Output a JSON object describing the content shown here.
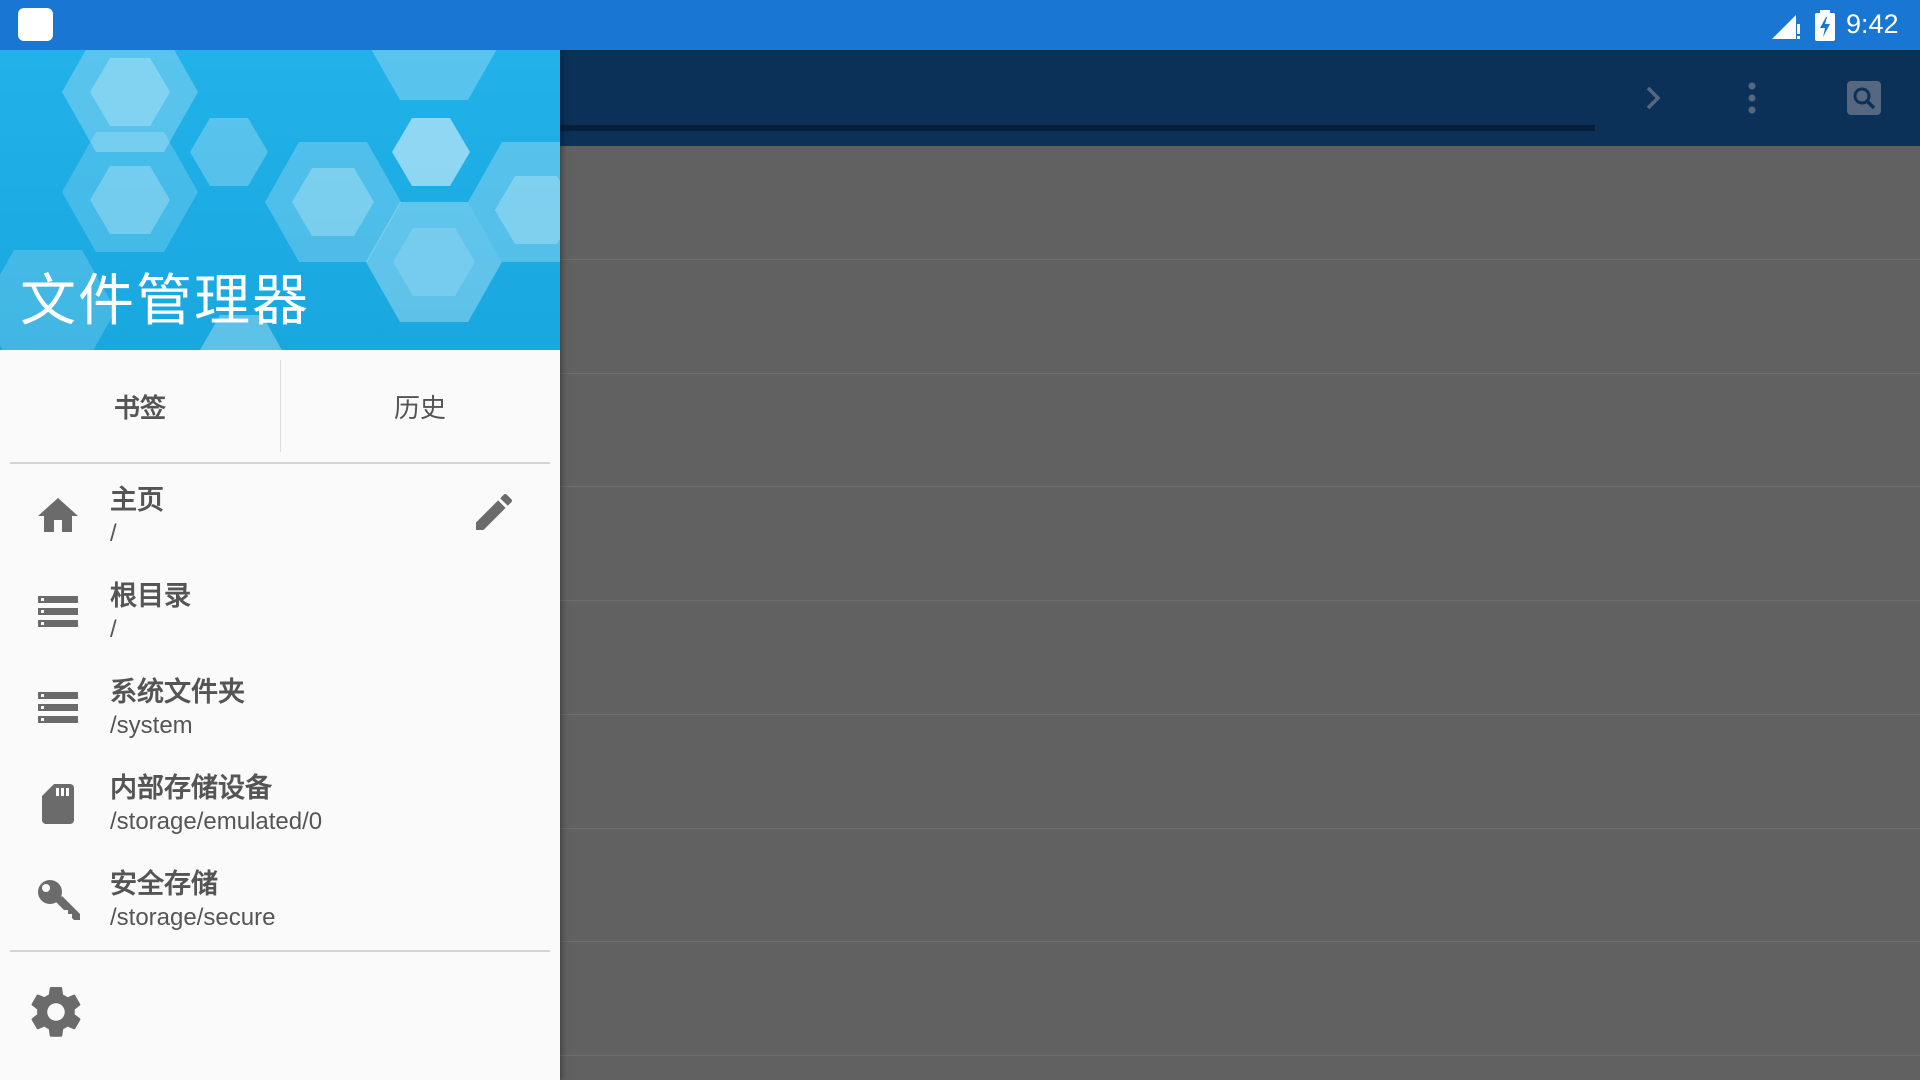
{
  "status_bar": {
    "time": "9:42",
    "icons": [
      "app-notification-icon",
      "signal-icon",
      "battery-charging-icon"
    ]
  },
  "app_bar": {
    "icons": [
      "chevron-right-icon",
      "more-vert-icon",
      "search-icon"
    ]
  },
  "drawer": {
    "title": "文件管理器",
    "tabs": [
      {
        "label": "书签",
        "active": true
      },
      {
        "label": "历史",
        "active": false
      }
    ],
    "items": [
      {
        "title": "主页",
        "path": "/",
        "icon": "home-icon"
      },
      {
        "title": "根目录",
        "path": "/",
        "icon": "storage-icon"
      },
      {
        "title": "系统文件夹",
        "path": "/system",
        "icon": "storage-icon"
      },
      {
        "title": "内部存储设备",
        "path": "/storage/emulated/0",
        "icon": "sd-card-icon"
      },
      {
        "title": "安全存储",
        "path": "/storage/secure",
        "icon": "key-icon"
      }
    ],
    "edit_icon": "pencil-icon",
    "settings_icon": "gear-icon"
  },
  "colors": {
    "status_bar": "#1976D2",
    "header": "#1CADE4",
    "app_bar_dimmed": "#0B3158",
    "scrim": "#616161",
    "icon_gray": "#6b6b6b"
  }
}
